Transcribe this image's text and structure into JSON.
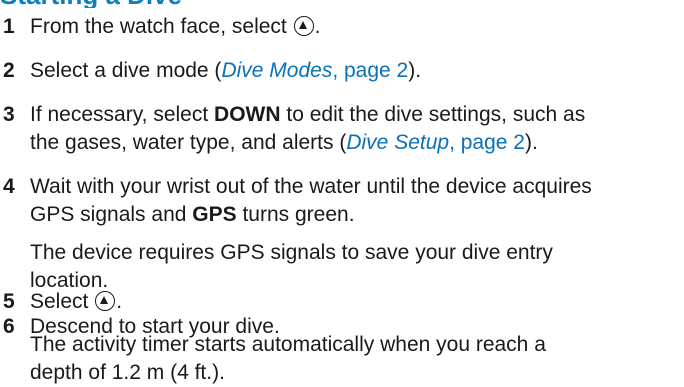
{
  "heading": {
    "text": "Starting a Dive"
  },
  "steps": [
    {
      "num": "1",
      "pre": "From the watch face, select ",
      "icon": "up-button-icon",
      "post": "."
    },
    {
      "num": "2",
      "pre": "Select a dive mode (",
      "link_title": "Dive Modes",
      "link_page": ", page 2",
      "post": ")."
    },
    {
      "num": "3",
      "pre": "If necessary, select ",
      "bold": "DOWN",
      "mid": " to edit the dive settings, such as",
      "line2_pre": "the gases, water type, and alerts (",
      "link_title": "Dive Setup",
      "link_page": ", page 2",
      "post": ")."
    },
    {
      "num": "4",
      "line1": "Wait with your wrist out of the water until the device acquires",
      "line2_pre": "GPS signals and ",
      "bold": "GPS",
      "line2_post": " turns green."
    },
    {
      "note": true,
      "line1": "The device requires GPS signals to save your dive entry",
      "line2": "location."
    },
    {
      "num": "5",
      "pre": "Select ",
      "icon": "up-button-icon",
      "post": "."
    },
    {
      "num": "6",
      "line1": "Descend to start your dive."
    },
    {
      "note": true,
      "line1": "The activity timer starts automatically when you reach a",
      "line2": "depth of 1.2 m (4 ft.)."
    }
  ]
}
